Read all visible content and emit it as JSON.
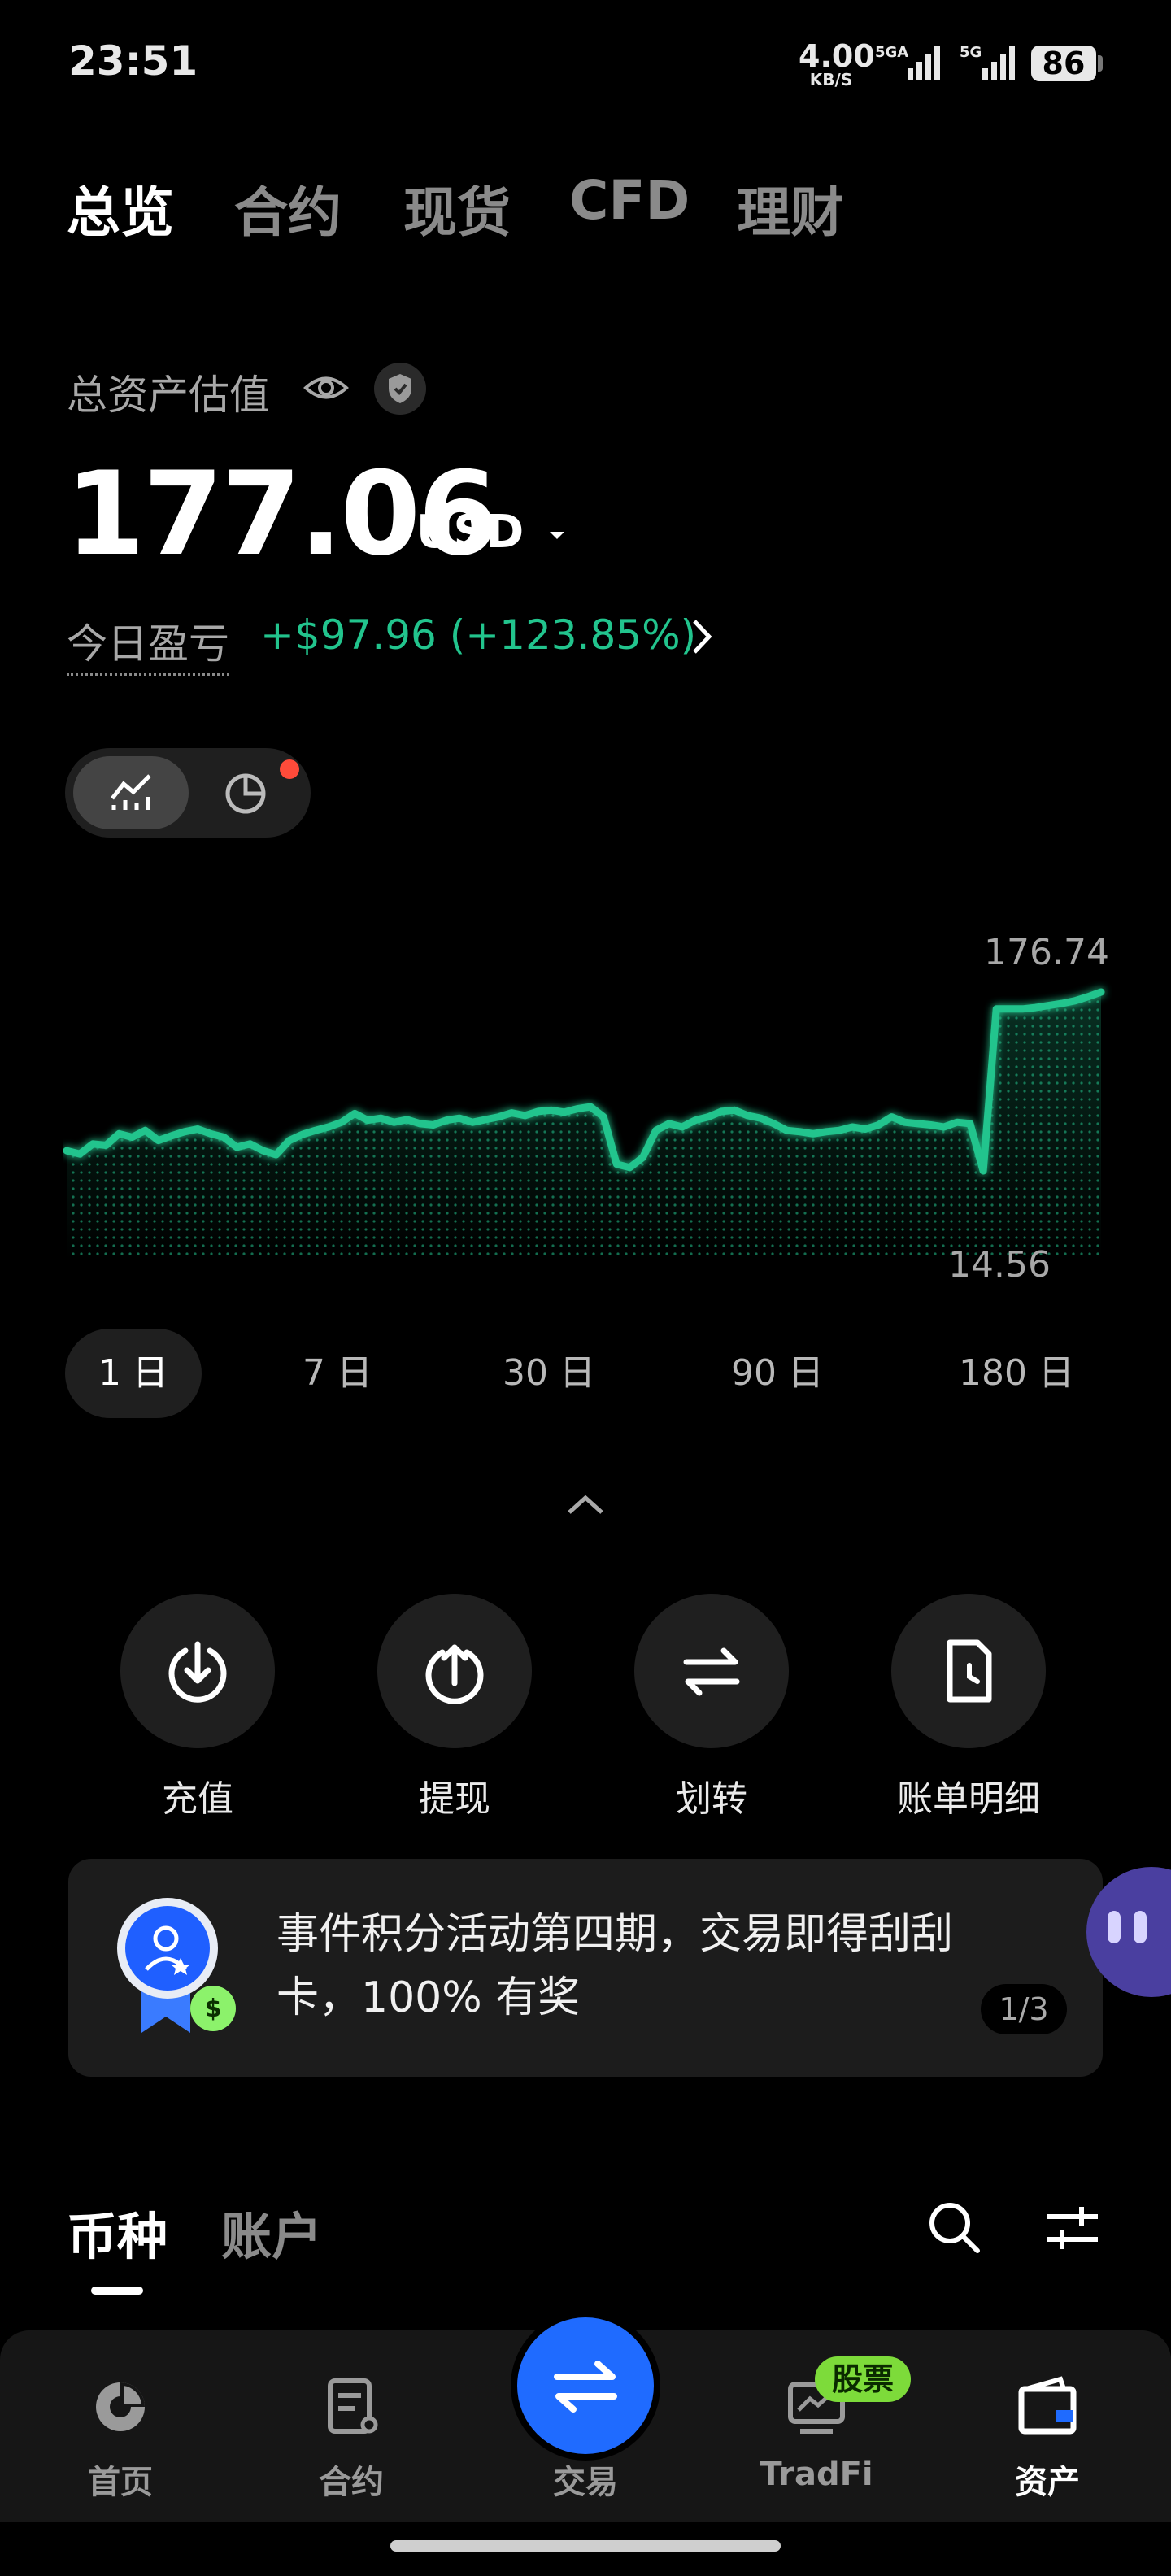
{
  "status_bar": {
    "time": "23:51",
    "net_speed_value": "4.00",
    "net_speed_unit": "KB/S",
    "sim1": "5GA",
    "sim2": "5G",
    "battery": "86"
  },
  "top_tabs": [
    "总览",
    "合约",
    "现货",
    "CFD",
    "理财"
  ],
  "active_top_tab": "总览",
  "asset": {
    "label": "总资产估值",
    "total": "177.06",
    "currency": "USD",
    "pnl_label": "今日盈亏",
    "pnl_value": "+$97.96 (+123.85%)"
  },
  "chart_data": {
    "type": "line",
    "max_label": "176.74",
    "min_label": "14.56",
    "color": "#22c48d",
    "values": [
      90,
      85,
      100,
      98,
      115,
      110,
      120,
      105,
      112,
      118,
      122,
      115,
      110,
      95,
      100,
      90,
      84,
      105,
      114,
      120,
      125,
      132,
      145,
      135,
      138,
      132,
      136,
      130,
      128,
      135,
      138,
      132,
      136,
      140,
      146,
      142,
      148,
      150,
      147,
      152,
      155,
      140,
      70,
      65,
      80,
      120,
      130,
      125,
      135,
      140,
      148,
      150,
      142,
      138,
      130,
      120,
      118,
      115,
      118,
      120,
      125,
      122,
      128,
      140,
      132,
      130,
      128,
      125,
      132,
      130,
      60,
      300,
      300,
      300,
      302,
      305,
      308,
      312,
      318,
      325
    ]
  },
  "ranges": [
    "1 日",
    "7 日",
    "30 日",
    "90 日",
    "180 日"
  ],
  "active_range": "1 日",
  "actions": [
    {
      "label": "充值",
      "icon": "deposit-icon"
    },
    {
      "label": "提现",
      "icon": "withdraw-icon"
    },
    {
      "label": "划转",
      "icon": "transfer-icon"
    },
    {
      "label": "账单明细",
      "icon": "bill-icon"
    }
  ],
  "banner": {
    "text": "事件积分活动第四期，交易即得刮刮卡，100% 有奖",
    "page": "1/3"
  },
  "sub_tabs": [
    "币种",
    "账户"
  ],
  "active_sub_tab": "币种",
  "bottom_nav": [
    {
      "label": "首页",
      "icon": "home-icon"
    },
    {
      "label": "合约",
      "icon": "contract-icon"
    },
    {
      "label": "交易",
      "icon": "trade-icon"
    },
    {
      "label": "TradFi",
      "icon": "tradfi-icon"
    },
    {
      "label": "资产",
      "icon": "wallet-icon"
    }
  ],
  "stock_badge": "股票",
  "colors": {
    "accent_green": "#22c48d",
    "brand_blue": "#1f6bff",
    "badge_green": "#7ddb3a"
  }
}
